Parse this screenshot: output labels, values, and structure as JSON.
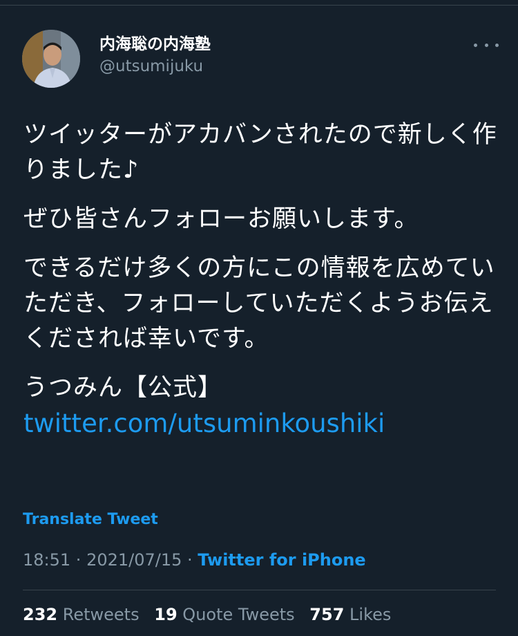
{
  "tweet": {
    "author": {
      "display_name": "内海聡の内海塾",
      "handle": "@utsumijuku"
    },
    "paragraphs": [
      "ツイッターがアカバンされたので新しく作りました♪",
      "ぜひ皆さんフォローお願いします。",
      "できるだけ多くの方にこの情報を広めていただき、フォローしていただくようお伝えくだされば幸いです。",
      "うつみん【公式】"
    ],
    "link_text": "twitter.com/utsuminkoushiki",
    "translate_label": "Translate Tweet",
    "time": "18:51",
    "date": "2021/07/15",
    "separator": " · ",
    "source": "Twitter for iPhone"
  },
  "stats": {
    "retweets_count": "232",
    "retweets_label": "Retweets",
    "quotes_count": "19",
    "quotes_label": "Quote Tweets",
    "likes_count": "757",
    "likes_label": "Likes"
  },
  "icons": {
    "more": "more-horizontal-icon"
  },
  "colors": {
    "background": "#15202b",
    "accent": "#1d9bf0",
    "secondary_text": "#8899a6",
    "divider": "#38444d"
  }
}
